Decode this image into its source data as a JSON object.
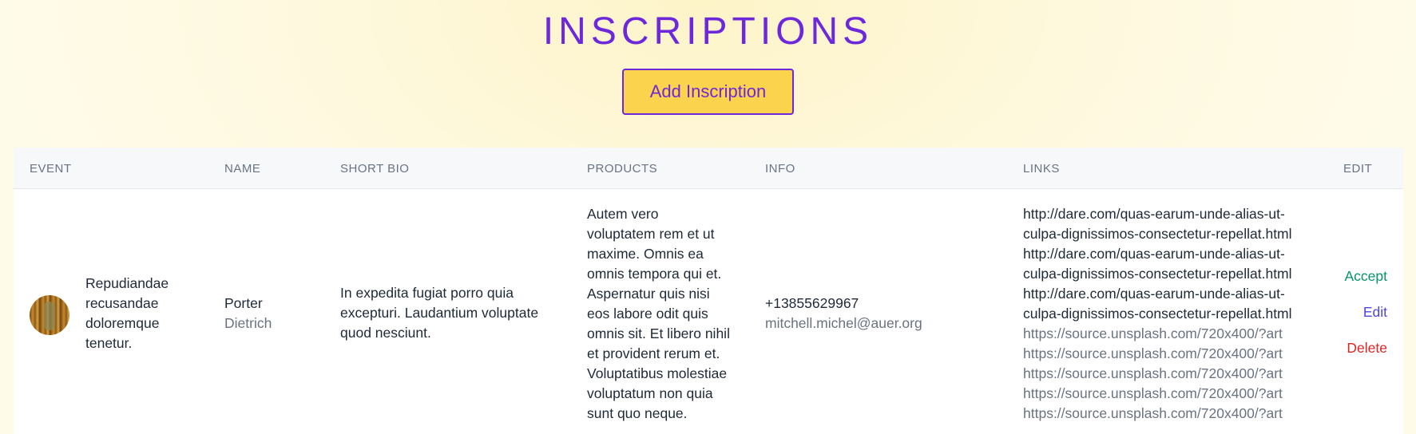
{
  "page": {
    "title": "INSCRIPTIONS"
  },
  "toolbar": {
    "add_label": "Add Inscription"
  },
  "table": {
    "headers": [
      "EVENT",
      "NAME",
      "SHORT BIO",
      "PRODUCTS",
      "INFO",
      "LINKS",
      "EDIT"
    ],
    "rows": [
      {
        "event": [
          "Repudiandae",
          "recusandae",
          "doloremque",
          "tenetur."
        ],
        "first_name": "Porter",
        "last_name": "Dietrich",
        "short_bio": [
          "In expedita fugiat porro quia",
          "excepturi. Laudantium voluptate",
          "quod nesciunt."
        ],
        "products": [
          "Autem vero",
          "voluptatem rem et ut",
          "maxime. Omnis ea",
          "omnis tempora qui et.",
          "Aspernatur quis nisi",
          "eos labore odit quis",
          "omnis sit. Et libero nihil",
          "et provident rerum et.",
          "Voluptatibus molestiae",
          "voluptatum non quia",
          "sunt quo neque."
        ],
        "phone": "+13855629967",
        "email": "mitchell.michel@auer.org",
        "links_primary": [
          "http://dare.com/quas-earum-unde-alias-ut-",
          "culpa-dignissimos-consectetur-repellat.html",
          "http://dare.com/quas-earum-unde-alias-ut-",
          "culpa-dignissimos-consectetur-repellat.html",
          "http://dare.com/quas-earum-unde-alias-ut-",
          "culpa-dignissimos-consectetur-repellat.html"
        ],
        "links_secondary": [
          "https://source.unsplash.com/720x400/?art",
          "https://source.unsplash.com/720x400/?art",
          "https://source.unsplash.com/720x400/?art",
          "https://source.unsplash.com/720x400/?art",
          "https://source.unsplash.com/720x400/?art"
        ],
        "actions": {
          "accept": "Accept",
          "edit": "Edit",
          "delete": "Delete"
        }
      }
    ]
  },
  "colors": {
    "accent": "#6d28d9",
    "button_bg": "#fcd34d",
    "accept": "#059669",
    "edit": "#4f46e5",
    "delete": "#dc2626"
  }
}
